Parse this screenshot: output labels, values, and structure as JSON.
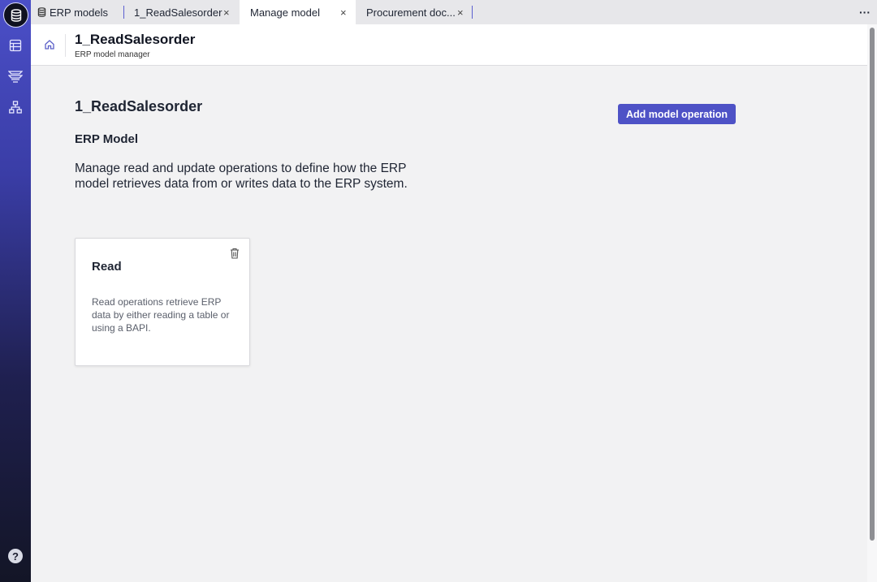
{
  "tabs": [
    {
      "label": "ERP models",
      "icon": "database-icon",
      "closable": false,
      "active": false
    },
    {
      "label": "1_ReadSalesorder",
      "closable": true,
      "active": false
    },
    {
      "label": "Manage model",
      "closable": true,
      "active": true
    },
    {
      "label": "Procurement doc...",
      "closable": true,
      "active": false
    }
  ],
  "tabbar": {
    "close_glyph": "×",
    "more_glyph": "···"
  },
  "sidebar": {
    "logo_icon": "database-icon",
    "items": [
      "table-icon",
      "layers-icon",
      "hierarchy-icon"
    ],
    "help_label": "?"
  },
  "header": {
    "title": "1_ReadSalesorder",
    "subtitle": "ERP model manager"
  },
  "main": {
    "title": "1_ReadSalesorder",
    "add_button_label": "Add model operation",
    "section_title": "ERP Model",
    "description": "Manage read and update operations to define how the ERP model retrieves data from or writes data to the ERP system."
  },
  "cards": [
    {
      "title": "Read",
      "description": "Read operations retrieve ERP data by either reading a table or using a BAPI."
    }
  ],
  "colors": {
    "accent": "#4e52c6",
    "sidebar_top": "#4b4fc8",
    "sidebar_bottom": "#131526"
  }
}
